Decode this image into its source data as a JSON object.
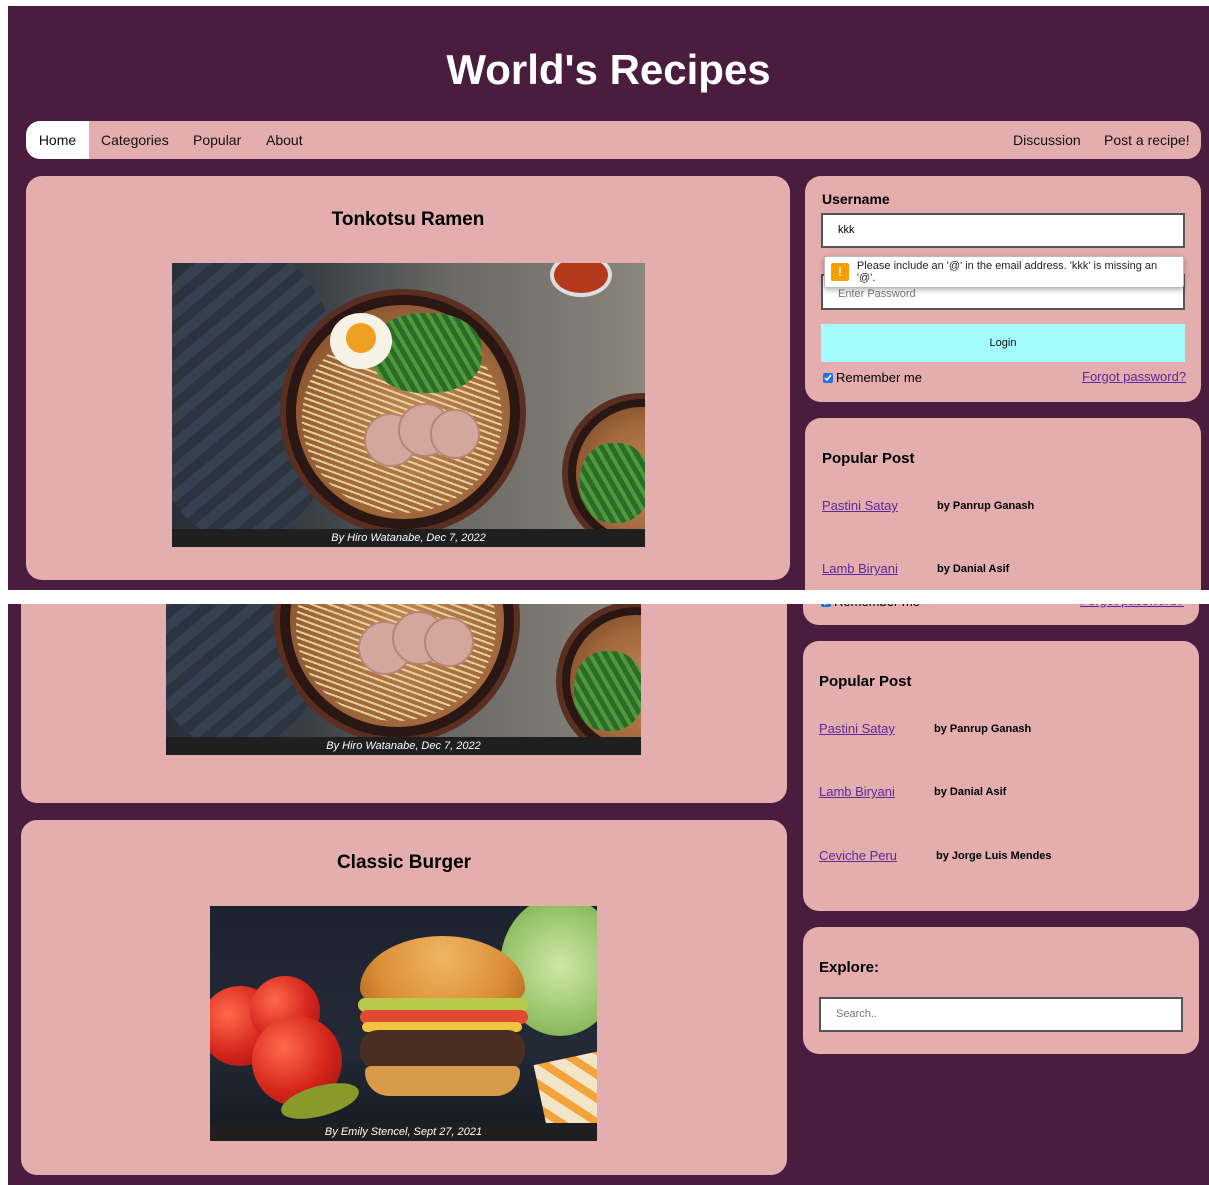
{
  "header": {
    "title": "World's Recipes"
  },
  "nav": {
    "left": [
      "Home",
      "Categories",
      "Popular",
      "About"
    ],
    "right": [
      "Discussion",
      "Post a recipe!"
    ]
  },
  "recipes": [
    {
      "title": "Tonkotsu Ramen",
      "caption": "By Hiro Watanabe, Dec 7, 2022"
    },
    {
      "title": "Classic Burger",
      "caption": "By Emily Stencel, Sept 27, 2021"
    }
  ],
  "login": {
    "username_label": "Username",
    "username_value": "kkk",
    "password_placeholder": "Enter Password",
    "login_button": "Login",
    "remember_label": "Remember me",
    "remember_checked": true,
    "forgot_link": "Forgot password?",
    "validation_message": "Please include an '@' in the email address. 'kkk' is missing an '@'."
  },
  "popular": {
    "title": "Popular Post",
    "posts": [
      {
        "name": "Pastini Satay",
        "author": "by Panrup Ganash"
      },
      {
        "name": "Lamb Biryani",
        "author": "by Danial Asif"
      },
      {
        "name": "Ceviche Peru",
        "author": "by Jorge Luis Mendes"
      }
    ]
  },
  "explore": {
    "title": "Explore:",
    "search_placeholder": "Search.."
  },
  "colors": {
    "page_bg": "#4a1d3f",
    "card_bg": "#e4aeae",
    "login_button": "#a3fbfb",
    "link": "#5a2a9a",
    "warning": "#f5a000"
  }
}
